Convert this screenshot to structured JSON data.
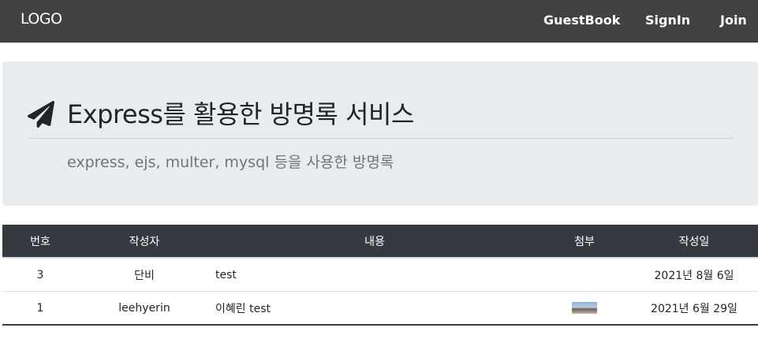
{
  "navbar": {
    "logo": "LOGO",
    "links": [
      "GuestBook",
      "SignIn",
      "Join"
    ]
  },
  "jumbotron": {
    "icon": "paper-plane-icon",
    "title": "Express를 활용한 방명록 서비스",
    "subtitle": "express, ejs, multer, mysql 등을 사용한 방명록"
  },
  "table": {
    "headers": [
      "번호",
      "작성자",
      "내용",
      "첨부",
      "작성일"
    ],
    "rows": [
      {
        "no": "3",
        "author": "단비",
        "content": "test",
        "attachment": "",
        "date": "2021년 8월 6일"
      },
      {
        "no": "1",
        "author": "leehyerin",
        "content": "이혜린 test",
        "attachment": "image-thumbnail",
        "date": "2021년 6월 29일"
      }
    ]
  },
  "colors": {
    "navbar_bg": "#424242",
    "jumbotron_bg": "#e9ecef",
    "table_header_bg": "#343a40"
  }
}
